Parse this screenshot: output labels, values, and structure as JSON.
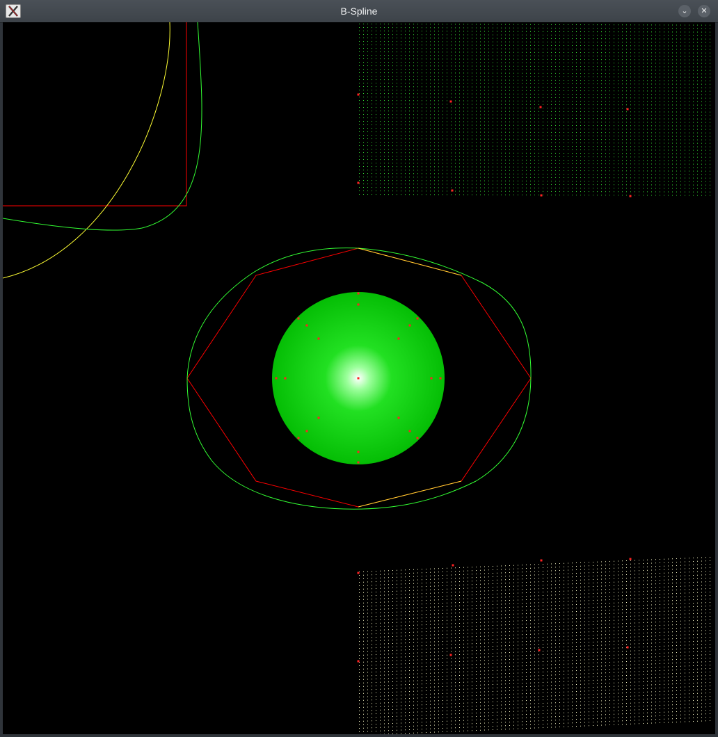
{
  "window": {
    "title": "B-Spline",
    "app_icon": "x-icon",
    "controls": {
      "minimize_icon": "chevron-down-icon",
      "minimize_glyph": "⌄",
      "close_icon": "close-icon",
      "close_glyph": "✕"
    }
  },
  "colors": {
    "background": "#000000",
    "spline": "#33ff33",
    "control_polygon": "#ff0000",
    "alt_spline": "#ffff33",
    "sphere": "#00d800",
    "points_top": "#33dd33",
    "points_bottom": "#ffffcc"
  }
}
